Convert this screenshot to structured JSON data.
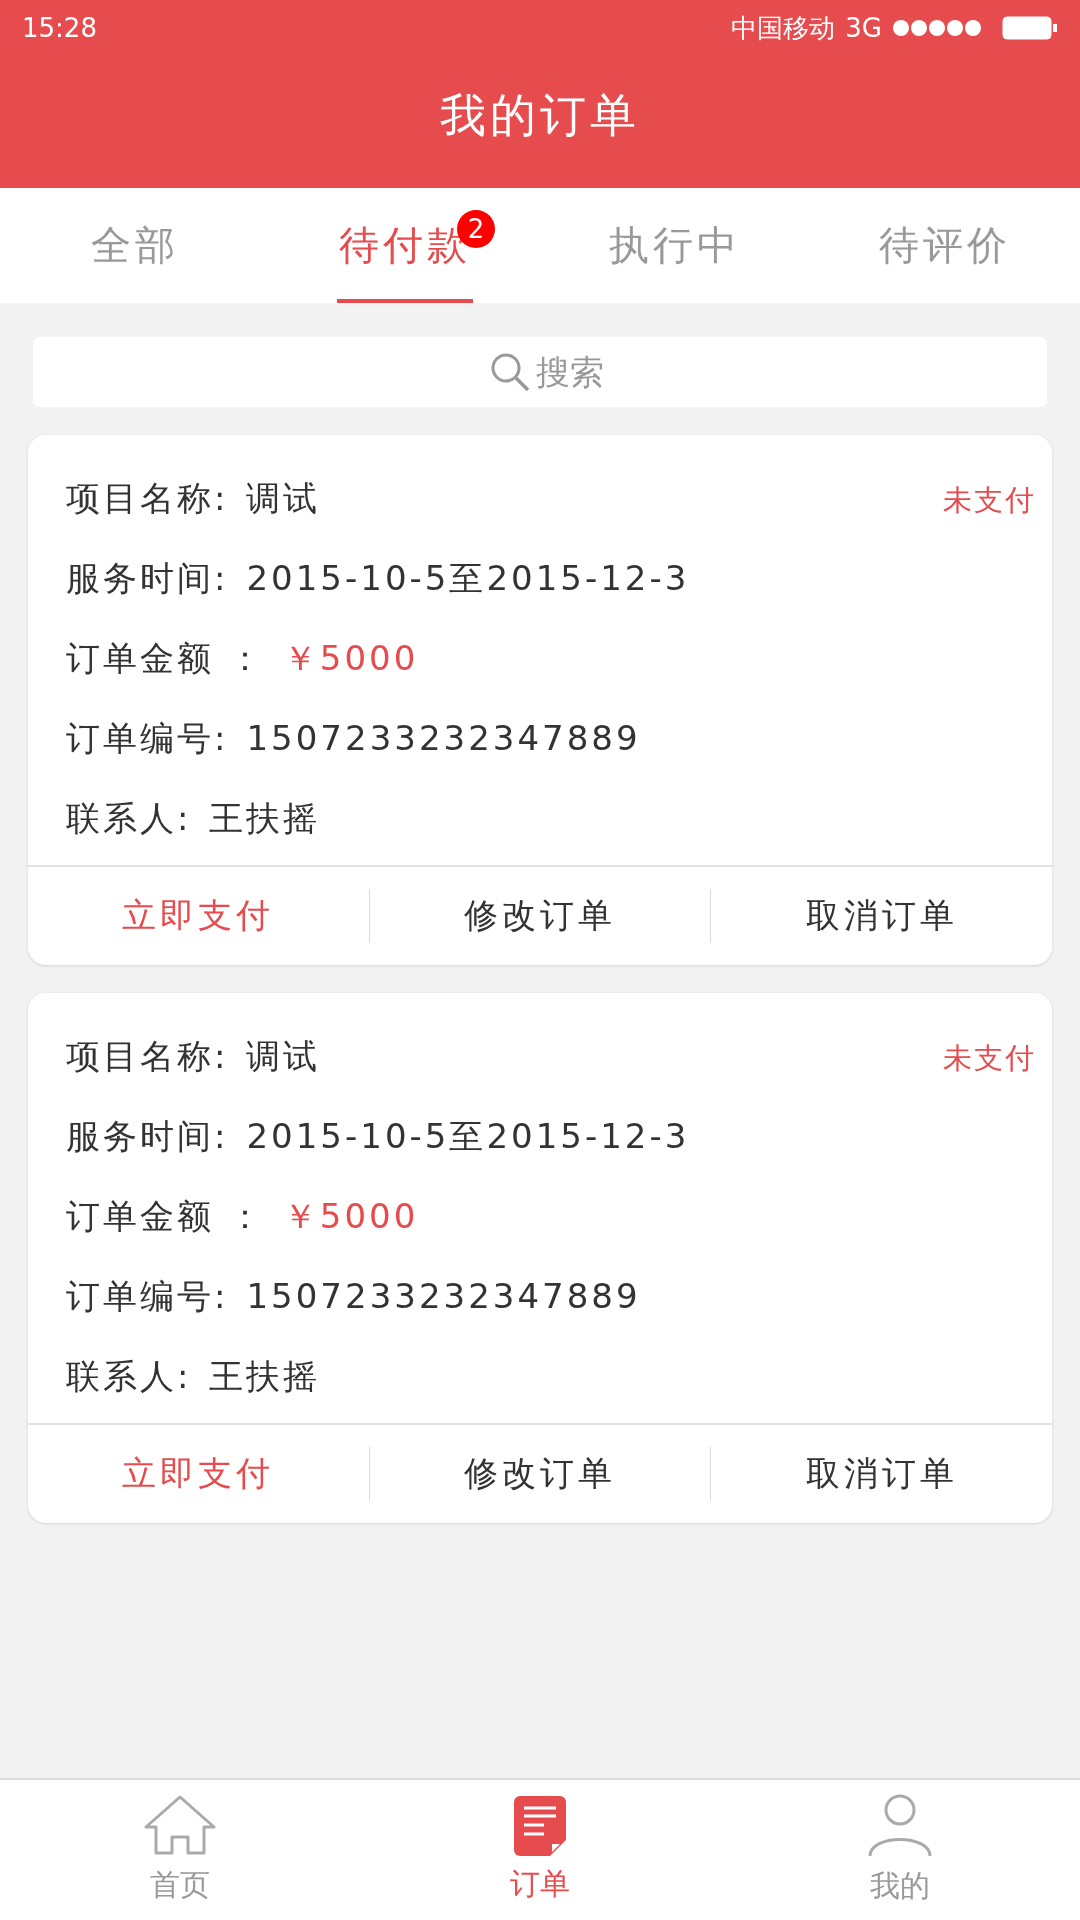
{
  "status_bar": {
    "time": "15:28",
    "carrier": "中国移动",
    "network": "3G"
  },
  "header": {
    "title": "我的订单"
  },
  "tabs": [
    {
      "label": "全部",
      "selected": false
    },
    {
      "label": "待付款",
      "selected": true,
      "badge": "2"
    },
    {
      "label": "执行中",
      "selected": false
    },
    {
      "label": "待评价",
      "selected": false
    }
  ],
  "search": {
    "placeholder": "搜索"
  },
  "orders": [
    {
      "status": "未支付",
      "fields": [
        {
          "label": "项目名称:",
          "value": "调试",
          "highlight": false
        },
        {
          "label": "服务时间:",
          "value": "2015-10-5至2015-12-3",
          "highlight": false
        },
        {
          "label": "订单金额 ：",
          "value": "￥5000",
          "highlight": true
        },
        {
          "label": "订单编号:",
          "value": "1507233232347889",
          "highlight": false
        },
        {
          "label": "联系人:",
          "value": "王扶摇",
          "highlight": false
        }
      ],
      "actions": [
        {
          "label": "立即支付",
          "primary": true
        },
        {
          "label": "修改订单",
          "primary": false
        },
        {
          "label": "取消订单",
          "primary": false
        }
      ]
    },
    {
      "status": "未支付",
      "fields": [
        {
          "label": "项目名称:",
          "value": "调试",
          "highlight": false
        },
        {
          "label": "服务时间:",
          "value": "2015-10-5至2015-12-3",
          "highlight": false
        },
        {
          "label": "订单金额 ：",
          "value": "￥5000",
          "highlight": true
        },
        {
          "label": "订单编号:",
          "value": "1507233232347889",
          "highlight": false
        },
        {
          "label": "联系人:",
          "value": "王扶摇",
          "highlight": false
        }
      ],
      "actions": [
        {
          "label": "立即支付",
          "primary": true
        },
        {
          "label": "修改订单",
          "primary": false
        },
        {
          "label": "取消订单",
          "primary": false
        }
      ]
    }
  ],
  "bottom_nav": [
    {
      "kind": "home",
      "label": "首页",
      "selected": false
    },
    {
      "kind": "orders",
      "label": "订单",
      "selected": true
    },
    {
      "kind": "profile",
      "label": "我的",
      "selected": false
    }
  ]
}
